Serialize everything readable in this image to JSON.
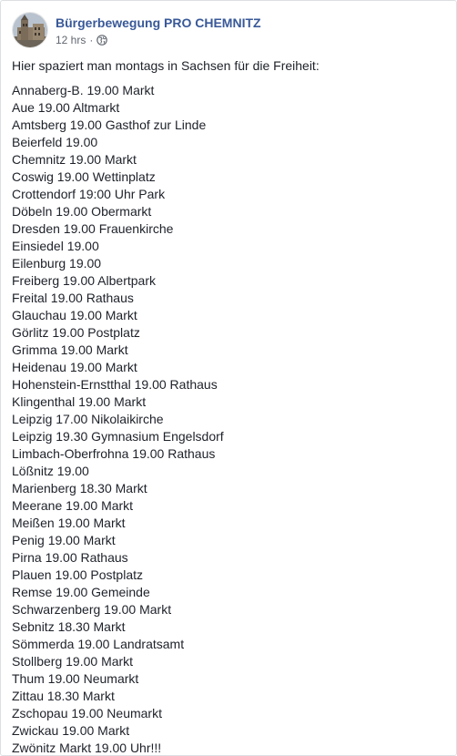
{
  "post": {
    "page_name": "Bürgerbewegung PRO CHEMNITZ",
    "timestamp": "12 hrs",
    "separator": "·",
    "privacy_icon": "globe-icon",
    "intro": "Hier spaziert man montags in Sachsen für die Freiheit:",
    "lines": [
      "Annaberg-B. 19.00 Markt",
      "Aue 19.00 Altmarkt",
      "Amtsberg 19.00 Gasthof zur Linde",
      "Beierfeld 19.00",
      "Chemnitz 19.00 Markt",
      "Coswig 19.00 Wettinplatz",
      "Crottendorf 19:00 Uhr Park",
      "Döbeln 19.00 Obermarkt",
      "Dresden 19.00 Frauenkirche",
      "Einsiedel 19.00",
      "Eilenburg 19.00",
      "Freiberg 19.00 Albertpark",
      "Freital 19.00 Rathaus",
      "Glauchau 19.00 Markt",
      "Görlitz 19.00 Postplatz",
      "Grimma 19.00 Markt",
      "Heidenau 19.00 Markt",
      "Hohenstein-Ernstthal 19.00 Rathaus",
      "Klingenthal 19.00 Markt",
      "Leipzig 17.00 Nikolaikirche",
      "Leipzig 19.30 Gymnasium Engelsdorf",
      "Limbach-Oberfrohna 19.00 Rathaus",
      "Lößnitz 19.00",
      "Marienberg 18.30 Markt",
      "Meerane 19.00 Markt",
      "Meißen 19.00 Markt",
      "Penig 19.00 Markt",
      "Pirna 19.00 Rathaus",
      "Plauen 19.00 Postplatz",
      "Remse 19.00 Gemeinde",
      "Schwarzenberg 19.00 Markt",
      "Sebnitz 18.30 Markt",
      "Sömmerda 19.00 Landratsamt",
      "Stollberg 19.00 Markt",
      "Thum 19.00 Neumarkt",
      "Zittau 18.30 Markt",
      "Zschopau 19.00 Neumarkt",
      "Zwickau 19.00 Markt",
      "Zwönitz Markt 19.00 Uhr!!!"
    ]
  },
  "colors": {
    "link_blue": "#385898",
    "text": "#1d2129",
    "secondary_text": "#616770",
    "border": "#dddfe2"
  }
}
